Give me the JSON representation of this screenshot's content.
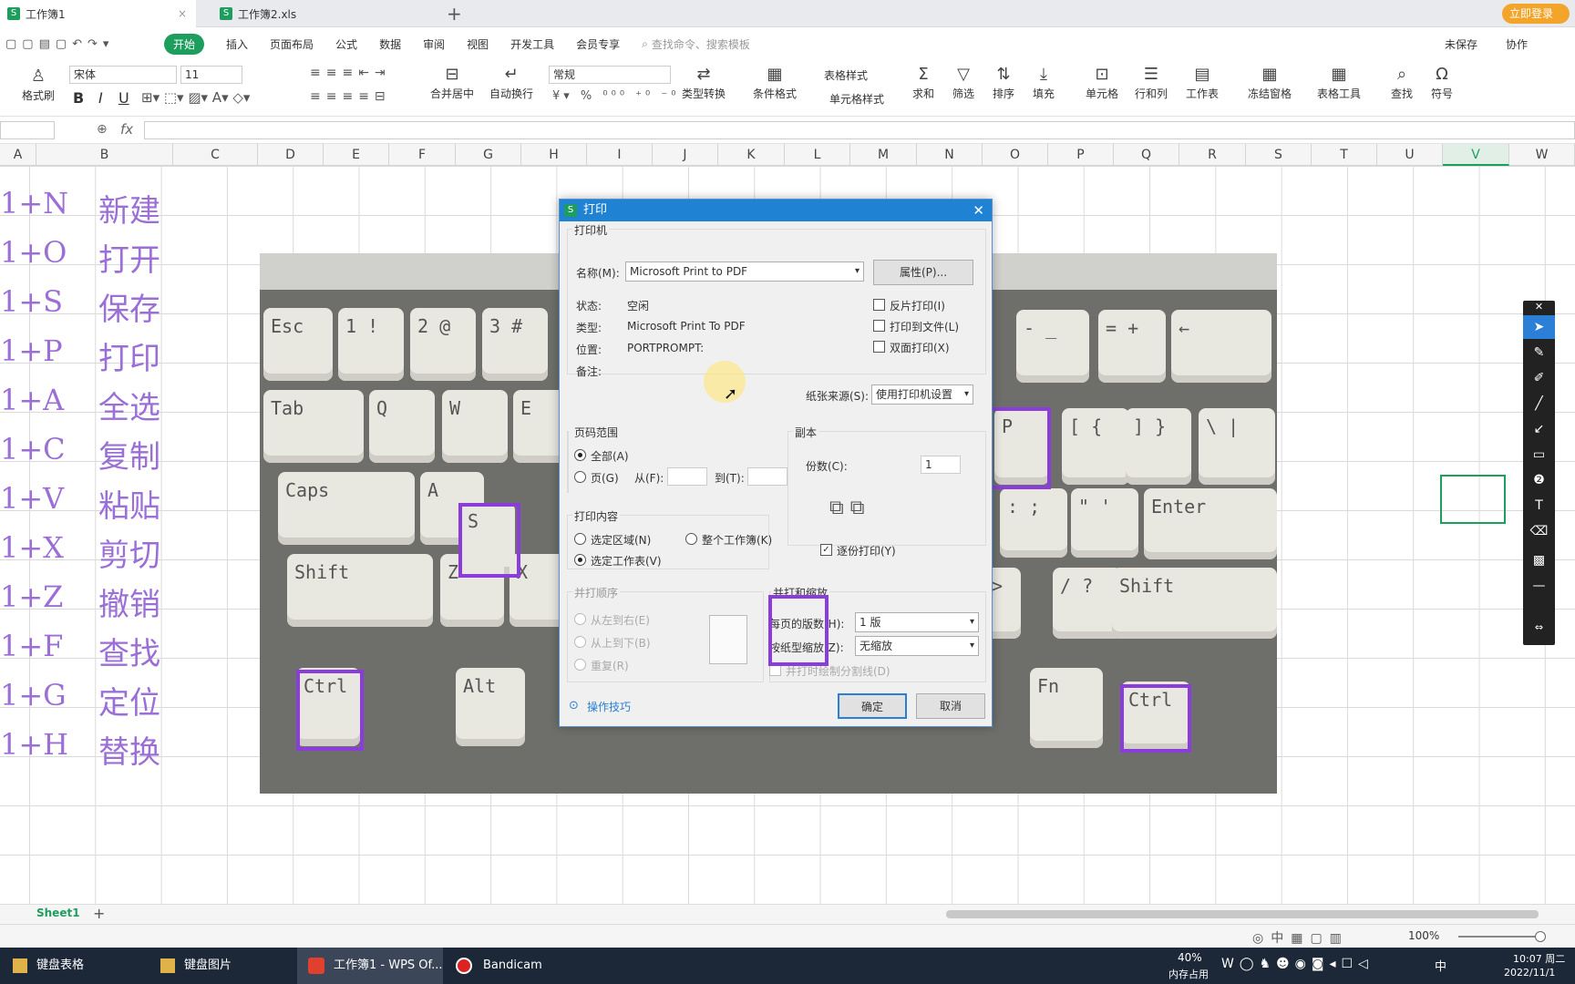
{
  "tabs": [
    {
      "label": "工作簿1",
      "icon": "spreadsheet-icon",
      "active": true
    },
    {
      "label": "工作簿2.xls",
      "icon": "spreadsheet-icon",
      "active": false
    }
  ],
  "header": {
    "login_button": "立即登录"
  },
  "menu": {
    "items": [
      "开始",
      "插入",
      "页面布局",
      "公式",
      "数据",
      "审阅",
      "视图",
      "开发工具",
      "会员专享"
    ],
    "search_placeholder": "查找命令、搜索模板",
    "unsaved": "未保存",
    "collaborate": "协作"
  },
  "ribbon": {
    "format_painter": "格式刷",
    "font_name": "宋体",
    "font_size": "11",
    "bold": "B",
    "italic": "I",
    "underline": "U",
    "merge_center": "合并居中",
    "wrap_text": "自动换行",
    "number_format": "常规",
    "type_convert": "类型转换",
    "conditional_format": "条件格式",
    "table_style": "表格样式",
    "cell_style": "单元格样式",
    "sum": "求和",
    "filter": "筛选",
    "sort": "排序",
    "fill": "填充",
    "cell": "单元格",
    "row_col": "行和列",
    "worksheet": "工作表",
    "freeze": "冻结窗格",
    "table_tools": "表格工具",
    "find": "查找",
    "symbol": "符号"
  },
  "formula": {
    "fx": "fx"
  },
  "columns": [
    "A",
    "B",
    "C",
    "D",
    "E",
    "F",
    "G",
    "H",
    "I",
    "J",
    "K",
    "L",
    "M",
    "N",
    "O",
    "P",
    "Q",
    "R",
    "S",
    "T",
    "U",
    "V",
    "W"
  ],
  "rows": [
    {
      "a": "1+N",
      "b": "新建"
    },
    {
      "a": "1+O",
      "b": "打开"
    },
    {
      "a": "1+S",
      "b": "保存"
    },
    {
      "a": "1+P",
      "b": "打印"
    },
    {
      "a": "1+A",
      "b": "全选"
    },
    {
      "a": "1+C",
      "b": "复制"
    },
    {
      "a": "1+V",
      "b": "粘贴"
    },
    {
      "a": "1+X",
      "b": "剪切"
    },
    {
      "a": "1+Z",
      "b": "撤销"
    },
    {
      "a": "1+F",
      "b": "查找"
    },
    {
      "a": "1+G",
      "b": "定位"
    },
    {
      "a": "1+H",
      "b": "替换"
    }
  ],
  "keyboard": {
    "keys": [
      "Esc",
      "1 !",
      "2 @",
      "3 #",
      "Tab",
      "Q",
      "W",
      "E",
      "Caps",
      "A",
      "S",
      "Shift",
      "Z",
      "X",
      "Ctrl",
      "Alt",
      "P",
      "[ {",
      "] }",
      "\\ |",
      "Enter",
      ": ;",
      "\" '",
      "> ",
      "/ ?",
      "Shift",
      "Fn",
      "Ctrl",
      "- _",
      "= +",
      "←"
    ]
  },
  "dialog": {
    "title": "打印",
    "printer_group": "打印机",
    "name_label": "名称(M):",
    "name_value": "Microsoft Print to PDF",
    "properties_button": "属性(P)...",
    "status_label": "状态:",
    "status_value": "空闲",
    "type_label": "类型:",
    "type_value": "Microsoft Print To PDF",
    "location_label": "位置:",
    "location_value": "PORTPROMPT:",
    "comment_label": "备注:",
    "reverse_print": "反片打印(I)",
    "print_to_file": "打印到文件(L)",
    "duplex": "双面打印(X)",
    "paper_source_label": "纸张来源(S):",
    "paper_source_value": "使用打印机设置",
    "range_group": "页码范围",
    "range_all": "全部(A)",
    "range_pages": "页(G)",
    "from_label": "从(F):",
    "to_label": "到(T):",
    "copies_group": "副本",
    "copies_label": "份数(C):",
    "copies_value": "1",
    "collate": "逐份打印(Y)",
    "content_group": "打印内容",
    "content_selection": "选定区域(N)",
    "content_workbook": "整个工作簿(K)",
    "content_sheet": "选定工作表(V)",
    "order_group": "并打顺序",
    "order_lr": "从左到右(E)",
    "order_tb": "从上到下(B)",
    "order_repeat": "重复(R)",
    "zoom_group": "并打和缩放",
    "pages_per_sheet_label": "每页的版数(H):",
    "pages_per_sheet_value": "1 版",
    "scale_label": "按纸型缩放(Z):",
    "scale_value": "无缩放",
    "draw_lines": "并打时绘制分割线(D)",
    "tips": "操作技巧",
    "ok": "确定",
    "cancel": "取消"
  },
  "sheet": {
    "tab": "Sheet1"
  },
  "status": {
    "zoom": "100%"
  },
  "taskbar": {
    "items": [
      {
        "label": "键盘表格",
        "icon": "folder-icon"
      },
      {
        "label": "键盘图片",
        "icon": "folder-icon"
      },
      {
        "label": "工作簿1 - WPS Of...",
        "icon": "wps-icon"
      },
      {
        "label": "Bandicam",
        "icon": "record-icon"
      }
    ],
    "memory": "40%",
    "memory_label": "内存占用",
    "ime": "中",
    "time": "10:07 周二",
    "date": "2022/11/1"
  },
  "colors": {
    "accent": "#1e9e5e",
    "highlight": "#8a3ddb",
    "cell_text": "#9b6fd6",
    "dialog_title": "#1f82d2"
  }
}
